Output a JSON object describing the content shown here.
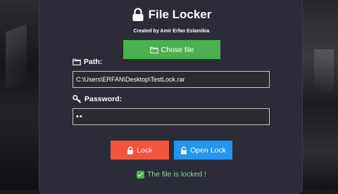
{
  "app": {
    "title": "File Locker",
    "subtitle": "Created by Amir Erfan Eslamikia"
  },
  "choose_button": {
    "label": "Chose file",
    "icon": "folder-icon",
    "color": "#4caf50"
  },
  "path": {
    "label": "Path:",
    "icon": "folder-icon",
    "value": "C:\\Users\\ERFAN\\Desktop\\TestLock.rar"
  },
  "password": {
    "label": "Password:",
    "icon": "key-icon",
    "value": "••"
  },
  "lock_button": {
    "label": "Lock",
    "icon": "lock-icon",
    "color": "#f4543b"
  },
  "open_button": {
    "label": "Open Lock",
    "icon": "unlock-icon",
    "color": "#2196f3"
  },
  "status": {
    "text": "The file is locked !",
    "icon": "checkmark-icon",
    "color": "#7ee081"
  }
}
